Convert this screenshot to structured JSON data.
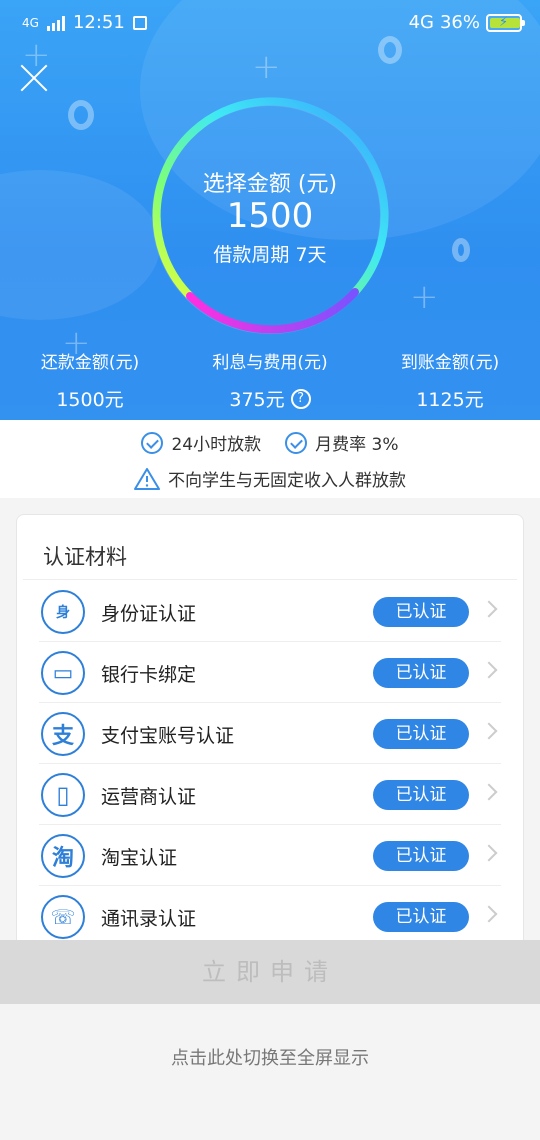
{
  "status_bar": {
    "network_left": "4G",
    "time": "12:51",
    "notif_icon": "message-icon",
    "network_right": "4G",
    "battery_percent": "36%",
    "battery_level": 0.36,
    "charging": true
  },
  "header": {
    "close_icon": "close-icon",
    "dial": {
      "title": "选择金额 (元)",
      "amount": "1500",
      "period": "借款周期 7天"
    },
    "stats": [
      {
        "label": "还款金额(元)",
        "value": "1500元"
      },
      {
        "label": "利息与费用(元)",
        "value": "375元",
        "help_icon": "question-icon",
        "help_glyph": "?"
      },
      {
        "label": "到账金额(元)",
        "value": "1125元"
      }
    ]
  },
  "notice": {
    "items": [
      "24小时放款",
      "月费率 3%"
    ],
    "warning": "不向学生与无固定收入人群放款"
  },
  "auth_card": {
    "title": "认证材料",
    "items": [
      {
        "icon": "id-card-icon",
        "glyph": "身",
        "label": "身份证认证",
        "status": "已认证"
      },
      {
        "icon": "bank-card-icon",
        "glyph": "▭",
        "label": "银行卡绑定",
        "status": "已认证"
      },
      {
        "icon": "alipay-icon",
        "glyph": "支",
        "label": "支付宝账号认证",
        "status": "已认证"
      },
      {
        "icon": "phone-icon",
        "glyph": "▯",
        "label": "运营商认证",
        "status": "已认证"
      },
      {
        "icon": "taobao-icon",
        "glyph": "淘",
        "label": "淘宝认证",
        "status": "已认证"
      },
      {
        "icon": "contacts-icon",
        "glyph": "☏",
        "label": "通讯录认证",
        "status": "已认证"
      }
    ]
  },
  "apply_button": {
    "label": "立即申请"
  },
  "fullscreen_hint": "点击此处切换至全屏显示",
  "colors": {
    "primary": "#2f8ff0",
    "badge": "#2f86e5",
    "icon": "#2e7fd8"
  }
}
